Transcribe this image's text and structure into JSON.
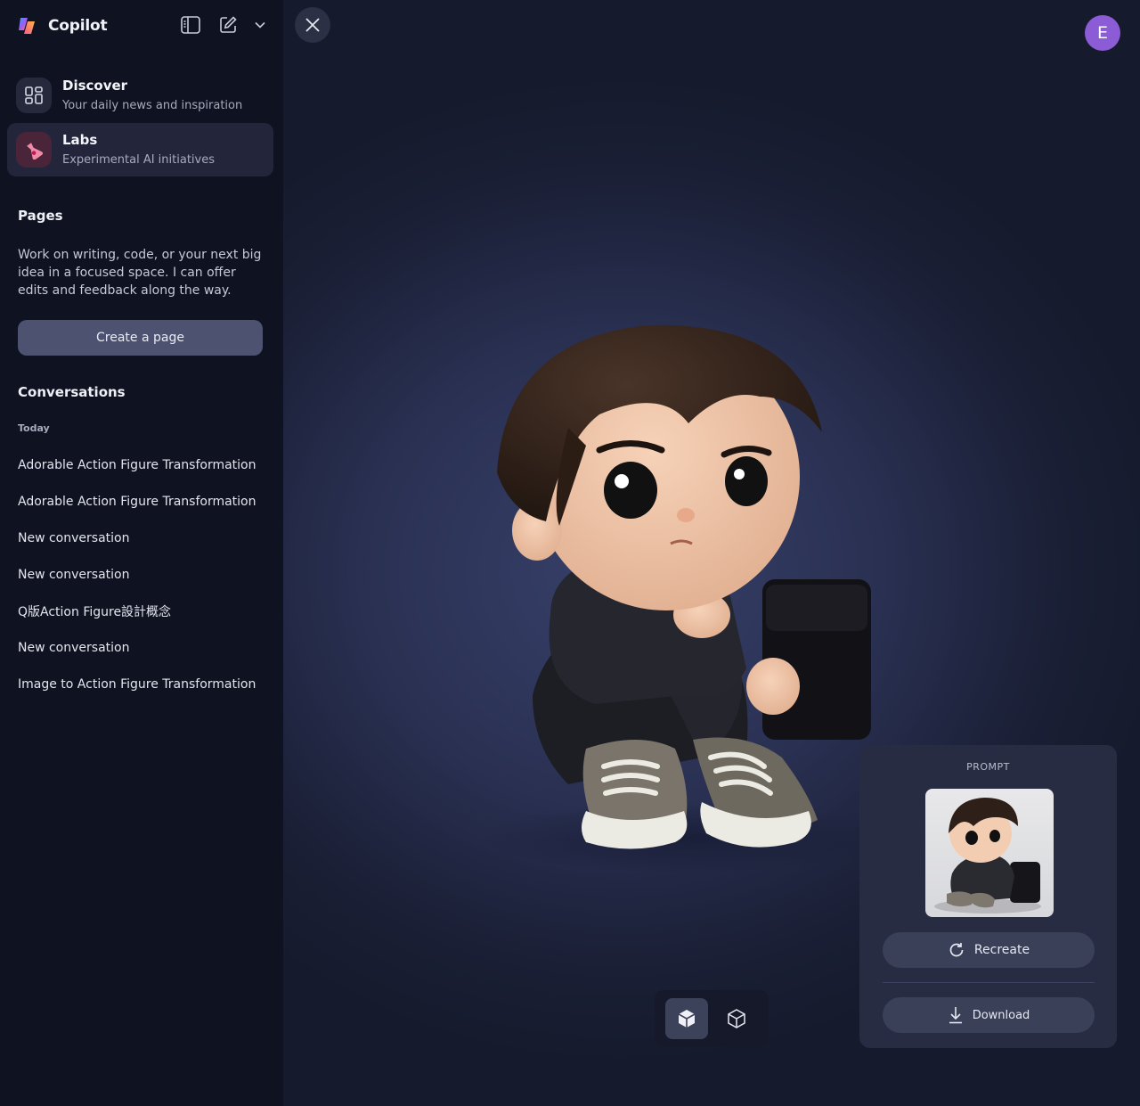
{
  "app": {
    "name": "Copilot"
  },
  "nav": [
    {
      "title": "Discover",
      "subtitle": "Your daily news and inspiration",
      "icon": "grid-icon"
    },
    {
      "title": "Labs",
      "subtitle": "Experimental AI initiatives",
      "icon": "flask-icon"
    }
  ],
  "pages": {
    "title": "Pages",
    "description": "Work on writing, code, or your next big idea in a focused space. I can offer edits and feedback along the way.",
    "create_label": "Create a page"
  },
  "conversations": {
    "title": "Conversations",
    "group_label": "Today",
    "items": [
      "Adorable Action Figure Transformation",
      "Adorable Action Figure Transformation",
      "New conversation",
      "New conversation",
      "Q版Action Figure設計概念",
      "New conversation",
      "Image to Action Figure Transformation"
    ]
  },
  "user": {
    "initial": "E",
    "color": "#8b5cd6"
  },
  "prompt_panel": {
    "label": "PROMPT",
    "recreate_label": "Recreate",
    "download_label": "Download"
  },
  "colors": {
    "accent": "#4c5270",
    "background": "#0f1221",
    "canvas": "#2a3153"
  }
}
